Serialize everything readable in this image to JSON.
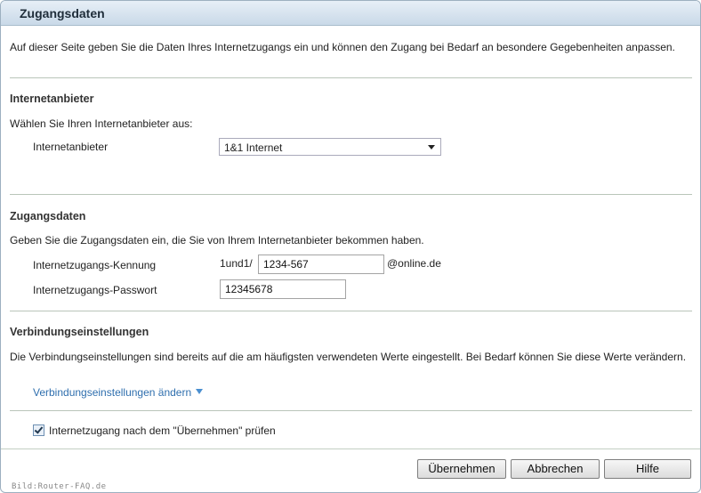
{
  "window": {
    "title": "Zugangsdaten"
  },
  "intro": "Auf dieser Seite geben Sie die Daten Ihres Internetzugangs ein und können den Zugang bei Bedarf an besondere Gegebenheiten anpassen.",
  "provider_section": {
    "heading": "Internetanbieter",
    "description": "Wählen Sie Ihren Internetanbieter aus:",
    "field_label": "Internetanbieter",
    "selected_value": "1&1 Internet"
  },
  "access_section": {
    "heading": "Zugangsdaten",
    "description": "Geben Sie die Zugangsdaten ein, die Sie von Ihrem Internetanbieter bekommen haben.",
    "login_label": "Internetzugangs-Kennung",
    "login_prefix": "1und1/",
    "login_value": "1234-567",
    "login_suffix": "@online.de",
    "password_label": "Internetzugangs-Passwort",
    "password_value": "12345678"
  },
  "connection_section": {
    "heading": "Verbindungseinstellungen",
    "description": "Die Verbindungseinstellungen sind bereits auf die am häufigsten verwendeten Werte eingestellt. Bei Bedarf können Sie diese Werte verändern.",
    "change_link": "Verbindungseinstellungen ändern"
  },
  "check_option": {
    "label": "Internetzugang nach dem \"Übernehmen\" prüfen",
    "checked": true
  },
  "buttons": {
    "apply": "Übernehmen",
    "cancel": "Abbrechen",
    "help": "Hilfe"
  },
  "watermark": "Bild:Router-FAQ.de"
}
